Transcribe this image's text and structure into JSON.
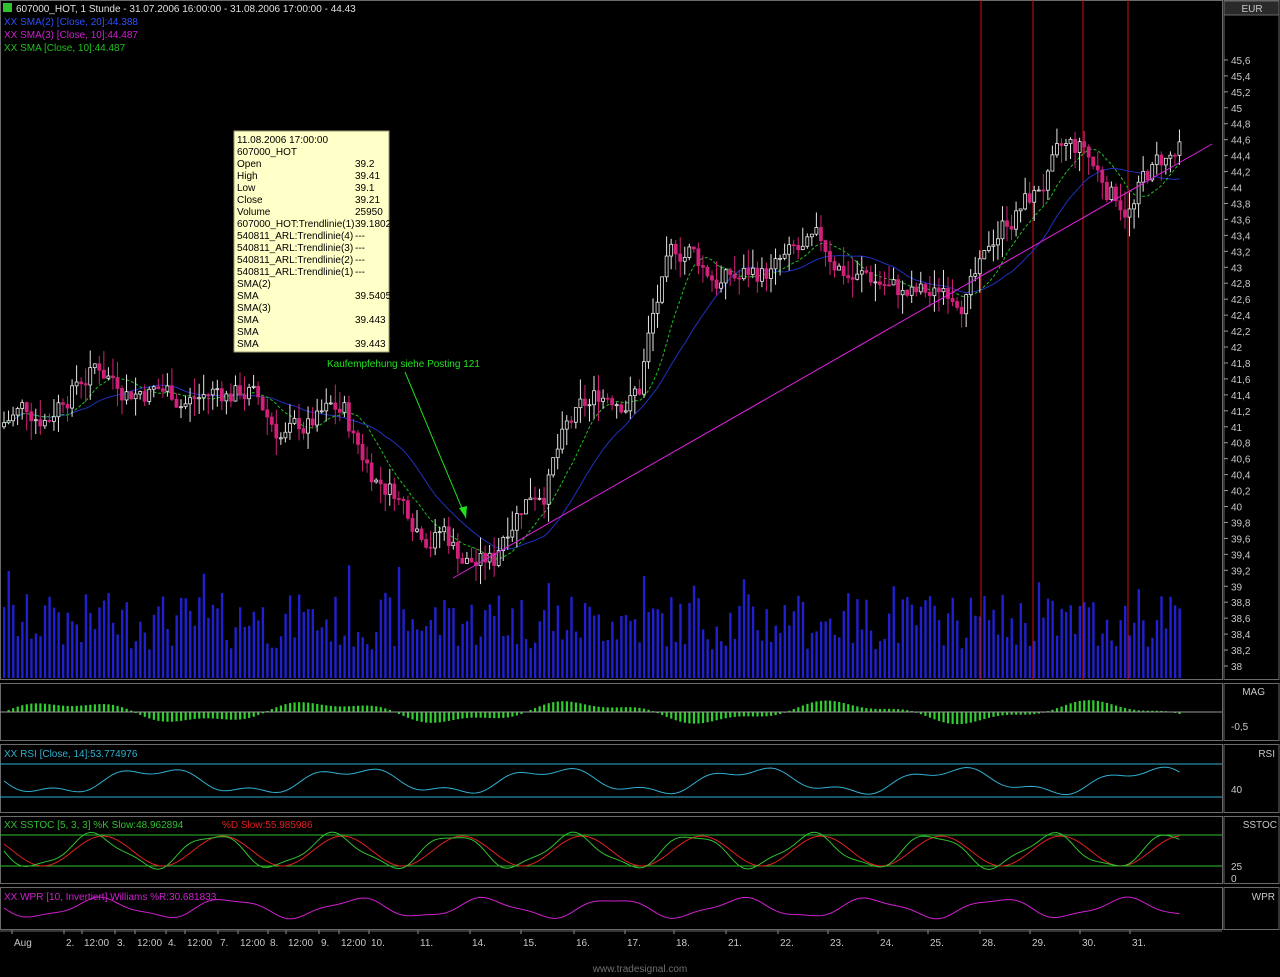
{
  "header": {
    "symbol_title": "607000_HOT, 1 Stunde - 31.07.2006 16:00:00 - 31.08.2006 17:00:00 - 44.43",
    "legend": [
      {
        "text": "XX SMA(2) [Close, 20]:44.388",
        "color": "#3050ff"
      },
      {
        "text": "XX SMA(3) [Close, 10]:44.487",
        "color": "#d020d0"
      },
      {
        "text": "XX SMA [Close, 10]:44.487",
        "color": "#20c020"
      }
    ]
  },
  "axis": {
    "currency": "EUR",
    "price_ticks": [
      "45,6",
      "45,4",
      "45,2",
      "45",
      "44,8",
      "44,6",
      "44,4",
      "44,2",
      "44",
      "43,8",
      "43,6",
      "43,4",
      "43,2",
      "43",
      "42,8",
      "42,6",
      "42,4",
      "42,2",
      "42",
      "41,8",
      "41,6",
      "41,4",
      "41,2",
      "41",
      "40,8",
      "40,6",
      "40,4",
      "40,2",
      "40",
      "39,8",
      "39,6",
      "39,4",
      "39,2",
      "39",
      "38,8",
      "38,6",
      "38,4",
      "38,2",
      "38"
    ],
    "x_labels": [
      "Aug",
      "2.",
      "12:00",
      "3.",
      "12:00",
      "4.",
      "12:00",
      "7.",
      "12:00",
      "8.",
      "12:00",
      "9.",
      "12:00",
      "10.",
      "11.",
      "14.",
      "15.",
      "16.",
      "17.",
      "18.",
      "21.",
      "22.",
      "23.",
      "24.",
      "25.",
      "28.",
      "29.",
      "30.",
      "31."
    ]
  },
  "tooltip": {
    "rows": [
      [
        "11.08.2006 17:00:00",
        ""
      ],
      [
        "607000_HOT",
        ""
      ],
      [
        "Open",
        "39.2"
      ],
      [
        "High",
        "39.41"
      ],
      [
        "Low",
        "39.1"
      ],
      [
        "Close",
        "39.21"
      ],
      [
        "Volume",
        "25950"
      ],
      [
        "607000_HOT:Trendlinie(1)",
        "39.1802"
      ],
      [
        "540811_ARL:Trendlinie(4)",
        "---"
      ],
      [
        "540811_ARL:Trendlinie(3)",
        "---"
      ],
      [
        "540811_ARL:Trendlinie(2)",
        "---"
      ],
      [
        "540811_ARL:Trendlinie(1)",
        "---"
      ],
      [
        "SMA(2)",
        ""
      ],
      [
        "SMA",
        "39.5405"
      ],
      [
        "SMA(3)",
        ""
      ],
      [
        "SMA",
        "39.443"
      ],
      [
        "SMA",
        ""
      ],
      [
        "SMA",
        "39.443"
      ]
    ]
  },
  "annotation": {
    "text": "Kaufempfehung siehe Posting 121"
  },
  "panels": {
    "mag": {
      "name": "MAG",
      "tick": "-0,5"
    },
    "rsi": {
      "name": "RSI",
      "legend": "XX RSI [Close, 14]:53.774976",
      "tick": "40"
    },
    "sstoc": {
      "name": "SSTOC",
      "legend_k": "XX SSTOC [5, 3, 3] %K Slow:48.962894",
      "legend_d": "%D Slow:55.985986",
      "tick_a": "25",
      "tick_b": "0"
    },
    "wpr": {
      "name": "WPR",
      "legend": "XX WPR [10, Invertiert] Williams %R:30.681833"
    }
  },
  "footer": {
    "watermark": "www.tradesignal.com"
  },
  "colors": {
    "up_candle": "#e8e8e8",
    "down_candle": "#d0207a",
    "volume": "#2020d0",
    "trendline": "#e020e0",
    "sma_fast": "#20c020",
    "sma_slow": "#2030c0",
    "vertical_markers": "#d01010",
    "rsi_line": "#30b0d0",
    "stoch_k": "#30c030",
    "stoch_d": "#e02020",
    "wpr_line": "#d020d0"
  },
  "chart_data": {
    "type": "candlestick",
    "x": [
      "31.07.",
      "1.08.",
      "2.08.",
      "3.08.",
      "4.08.",
      "7.08.",
      "8.08.",
      "9.08.",
      "10.08.",
      "11.08.",
      "14.08.",
      "15.08.",
      "16.08.",
      "17.08.",
      "18.08.",
      "21.08.",
      "22.08.",
      "23.08.",
      "24.08.",
      "25.08.",
      "28.08.",
      "29.08.",
      "30.08.",
      "31.08."
    ],
    "close": [
      41.3,
      41.9,
      41.6,
      41.4,
      41.5,
      40.8,
      41.1,
      40.2,
      39.8,
      39.2,
      40.6,
      41.2,
      41.6,
      43.4,
      42.8,
      43.0,
      43.0,
      42.8,
      42.5,
      43.0,
      44.0,
      44.4,
      43.8,
      44.43
    ],
    "ylim": [
      38,
      45.8
    ],
    "trendline_start": [
      "11.08.",
      39.18
    ],
    "trendline_end": [
      "31.08.",
      44.3
    ]
  }
}
